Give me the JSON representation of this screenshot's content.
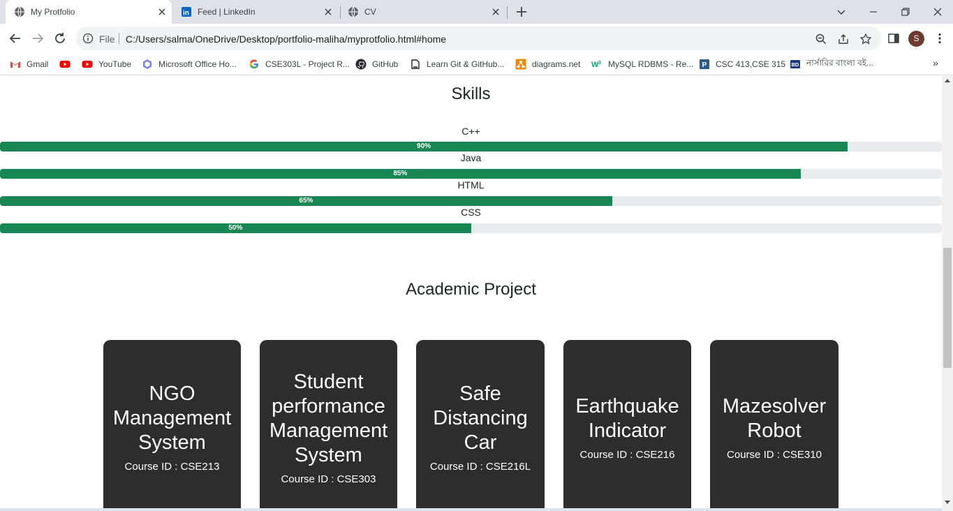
{
  "tabs": [
    {
      "label": "My Protfolio",
      "favicon": "globe-icon",
      "active": true
    },
    {
      "label": "Feed | LinkedIn",
      "favicon": "linkedin-icon",
      "active": false
    },
    {
      "label": "CV",
      "favicon": "globe-icon",
      "active": false
    }
  ],
  "address": {
    "scheme": "File",
    "url": "C:/Users/salma/OneDrive/Desktop/portfolio-maliha/myprotfolio.html#home"
  },
  "profile": {
    "initial": "S"
  },
  "bookmarks": [
    {
      "label": "Gmail",
      "icon": "gmail-icon"
    },
    {
      "label": "",
      "icon": "youtube-icon"
    },
    {
      "label": "YouTube",
      "icon": "youtube-icon"
    },
    {
      "label": "Microsoft Office Ho...",
      "icon": "office-icon"
    },
    {
      "label": "CSE303L - Project R...",
      "icon": "google-icon"
    },
    {
      "label": "GitHub",
      "icon": "github-icon"
    },
    {
      "label": "Learn Git & GitHub...",
      "icon": "learn-icon"
    },
    {
      "label": "diagrams.net",
      "icon": "diagrams-icon"
    },
    {
      "label": "MySQL RDBMS - Re...",
      "icon": "w3schools-icon"
    },
    {
      "label": "CSC 413,CSE 315",
      "icon": "p-icon"
    },
    {
      "label": "নার্সারির বাংলা বই...",
      "icon": "bd-icon"
    }
  ],
  "skills": {
    "title": "Skills",
    "items": [
      {
        "name": "C++",
        "percent": 90,
        "label": "90%"
      },
      {
        "name": "Java",
        "percent": 85,
        "label": "85%"
      },
      {
        "name": "HTML",
        "percent": 65,
        "label": "65%"
      },
      {
        "name": "CSS",
        "percent": 50,
        "label": "50%"
      }
    ]
  },
  "projects": {
    "title": "Academic Project",
    "items": [
      {
        "title": "NGO Management System",
        "course": "Course ID : CSE213"
      },
      {
        "title": "Student performance Management System",
        "course": "Course ID : CSE303"
      },
      {
        "title": "Safe Distancing Car",
        "course": "Course ID : CSE216L"
      },
      {
        "title": "Earthquake Indicator",
        "course": "Course ID : CSE216"
      },
      {
        "title": "Mazesolver Robot",
        "course": "Course ID : CSE310"
      }
    ]
  },
  "colors": {
    "progress_fill": "#198754",
    "progress_track": "#e9ecef",
    "card_bg": "#2d2d2d"
  }
}
